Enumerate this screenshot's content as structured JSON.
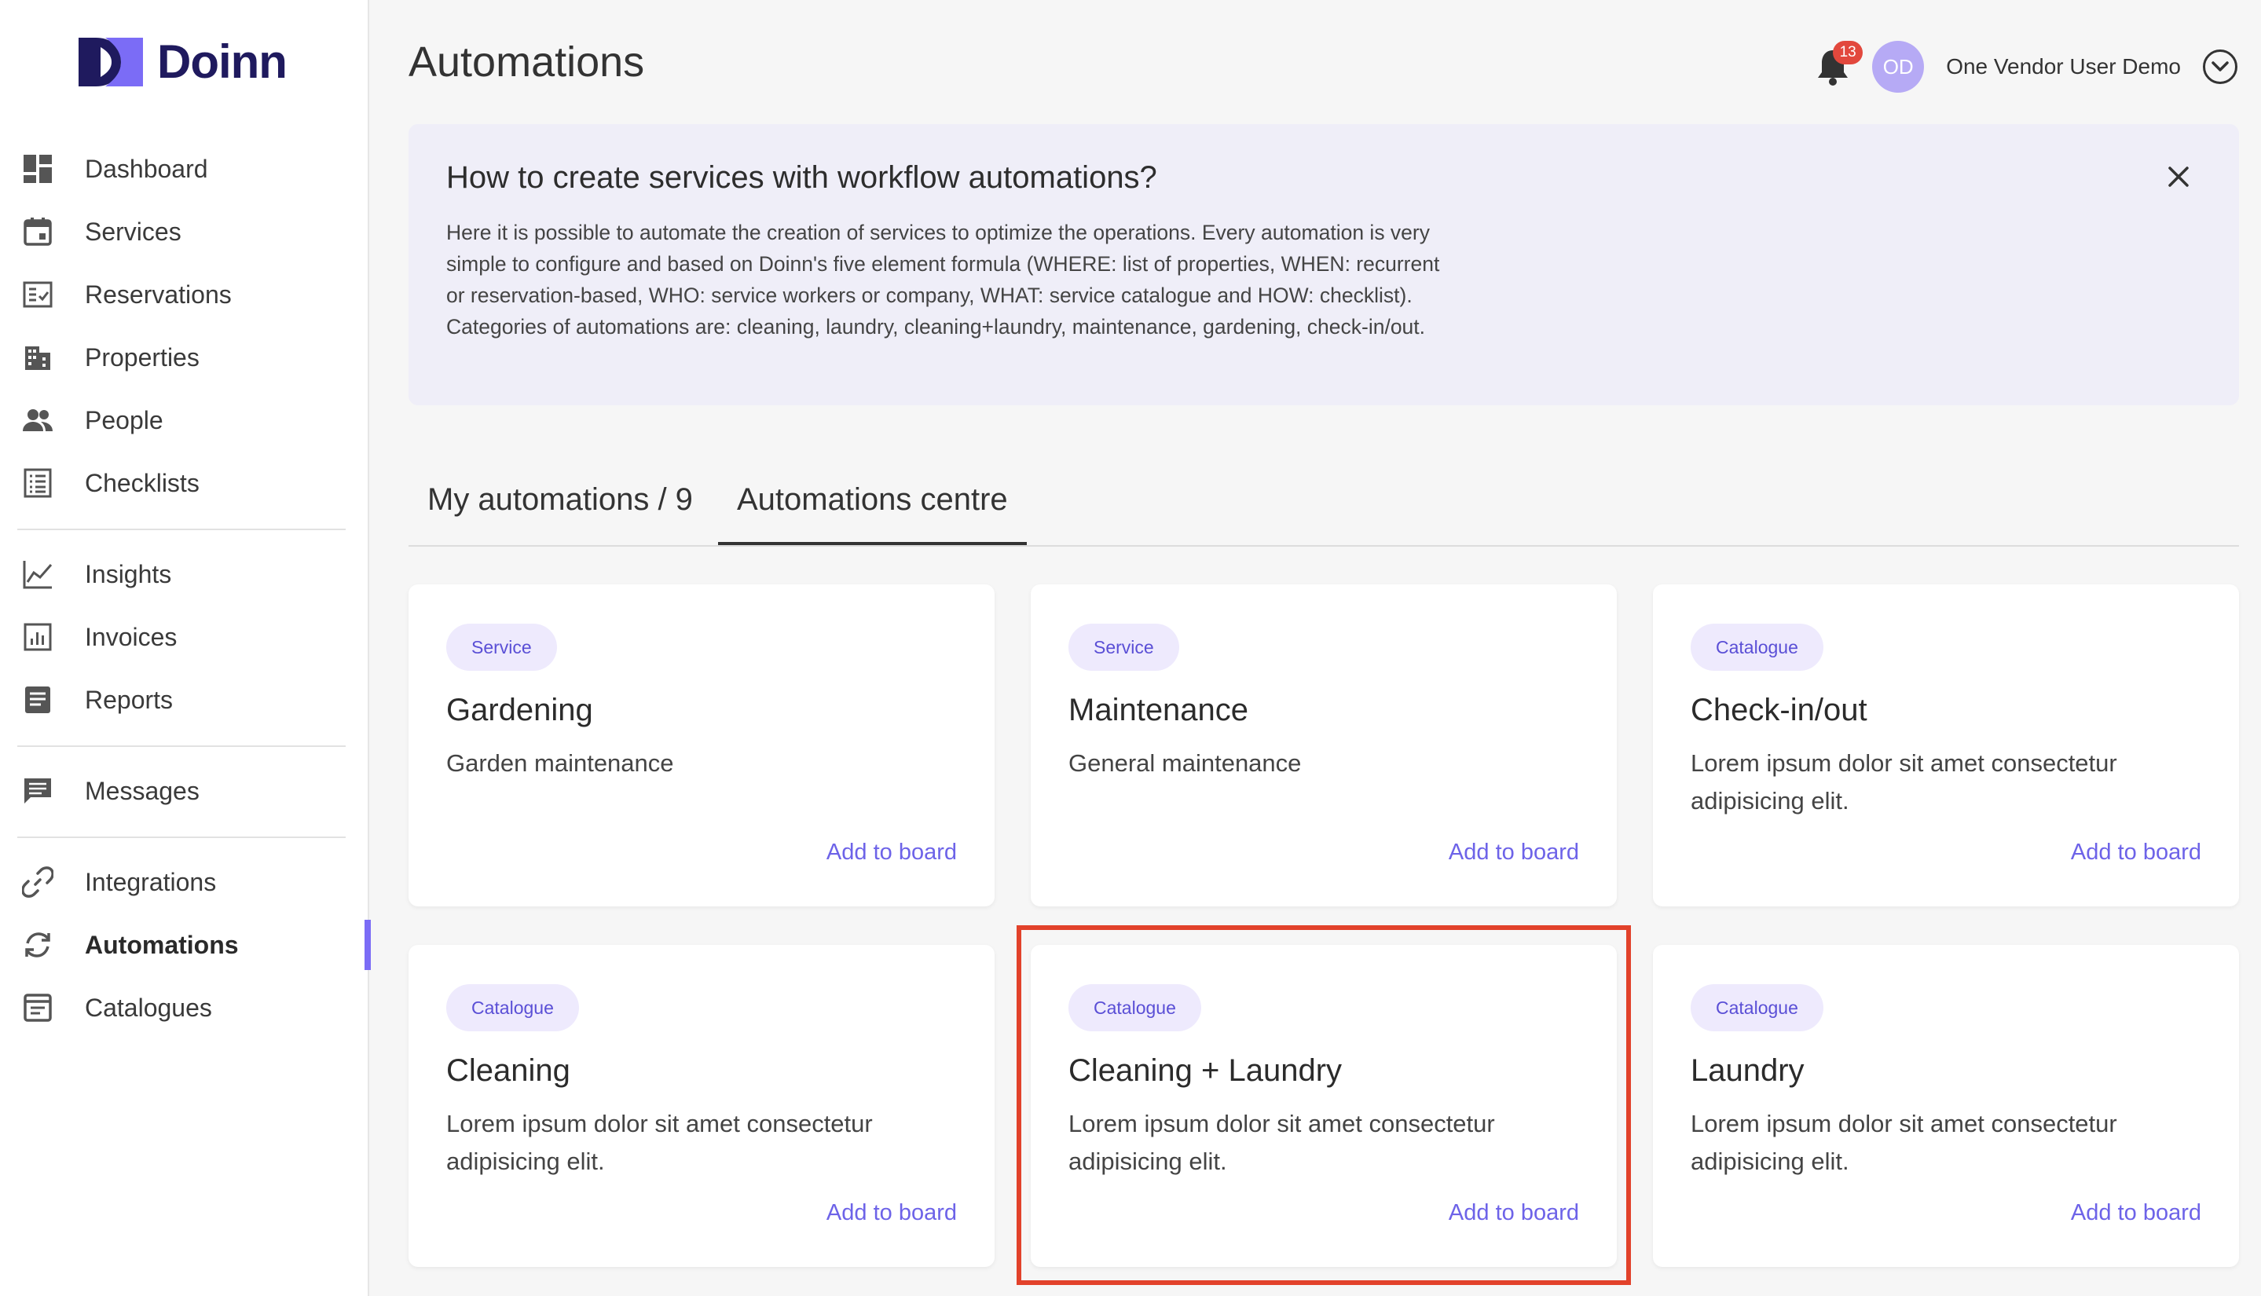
{
  "brand": {
    "name": "Doinn",
    "accent": "#7b6cf6",
    "logo_color": "#1f1a5e"
  },
  "sidebar": {
    "groups": [
      [
        {
          "label": "Dashboard",
          "icon": "dashboard-icon"
        },
        {
          "label": "Services",
          "icon": "calendar-icon"
        },
        {
          "label": "Reservations",
          "icon": "checklist-icon"
        },
        {
          "label": "Properties",
          "icon": "building-icon"
        },
        {
          "label": "People",
          "icon": "people-icon"
        },
        {
          "label": "Checklists",
          "icon": "list-icon"
        }
      ],
      [
        {
          "label": "Insights",
          "icon": "chart-line-icon"
        },
        {
          "label": "Invoices",
          "icon": "invoice-icon"
        },
        {
          "label": "Reports",
          "icon": "report-icon"
        }
      ],
      [
        {
          "label": "Messages",
          "icon": "message-icon"
        }
      ],
      [
        {
          "label": "Integrations",
          "icon": "link-icon"
        },
        {
          "label": "Automations",
          "icon": "sync-icon",
          "active": true
        },
        {
          "label": "Catalogues",
          "icon": "catalogue-icon"
        }
      ]
    ]
  },
  "header": {
    "title": "Automations",
    "notifications_count": "13",
    "avatar_initials": "OD",
    "user_name": "One Vendor User Demo"
  },
  "banner": {
    "title": "How to create services with workflow automations?",
    "lines": [
      "Here it is possible to automate the creation of services to optimize the operations. Every automation is very",
      "simple to configure and based on Doinn's five element formula (WHERE: list of properties, WHEN: recurrent",
      "or reservation-based, WHO: service workers or company, WHAT: service catalogue and HOW: checklist).",
      "Categories of automations are: cleaning, laundry, cleaning+laundry, maintenance, gardening, check-in/out."
    ]
  },
  "tabs": [
    {
      "label": "My automations / 9",
      "active": false
    },
    {
      "label": "Automations centre",
      "active": true
    }
  ],
  "cards": [
    {
      "tag": "Service",
      "title": "Gardening",
      "desc": "Garden maintenance",
      "action": "Add to board"
    },
    {
      "tag": "Service",
      "title": "Maintenance",
      "desc": "General maintenance",
      "action": "Add to board"
    },
    {
      "tag": "Catalogue",
      "title": "Check-in/out",
      "desc": "Lorem ipsum dolor sit amet consectetur adipisicing elit.",
      "action": "Add to board"
    },
    {
      "tag": "Catalogue",
      "title": "Cleaning",
      "desc": "Lorem ipsum dolor sit amet consectetur adipisicing elit.",
      "action": "Add to board"
    },
    {
      "tag": "Catalogue",
      "title": "Cleaning + Laundry",
      "desc": "Lorem ipsum dolor sit amet consectetur adipisicing elit.",
      "action": "Add to board",
      "highlighted": true
    },
    {
      "tag": "Catalogue",
      "title": "Laundry",
      "desc": "Lorem ipsum dolor sit amet consectetur adipisicing elit.",
      "action": "Add to board"
    }
  ]
}
